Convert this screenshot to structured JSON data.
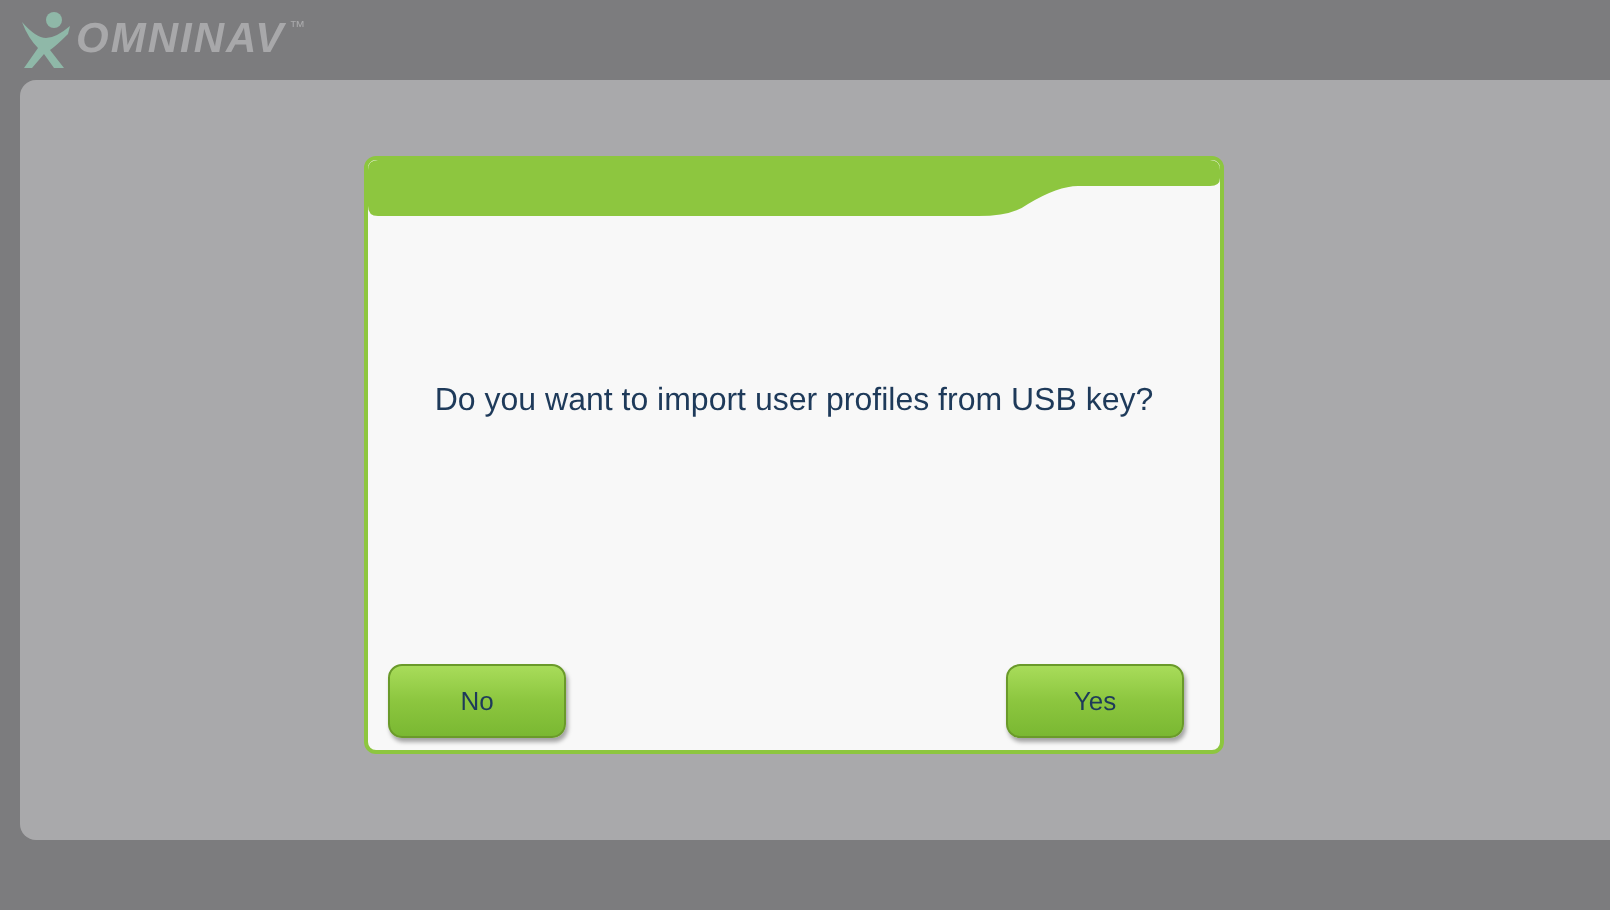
{
  "header": {
    "logo": "OMNINAV",
    "trademark": "™"
  },
  "dialog": {
    "message": "Do you want to import user profiles from USB key?",
    "buttons": [
      {
        "label": "No"
      },
      {
        "label": "Yes"
      }
    ]
  }
}
